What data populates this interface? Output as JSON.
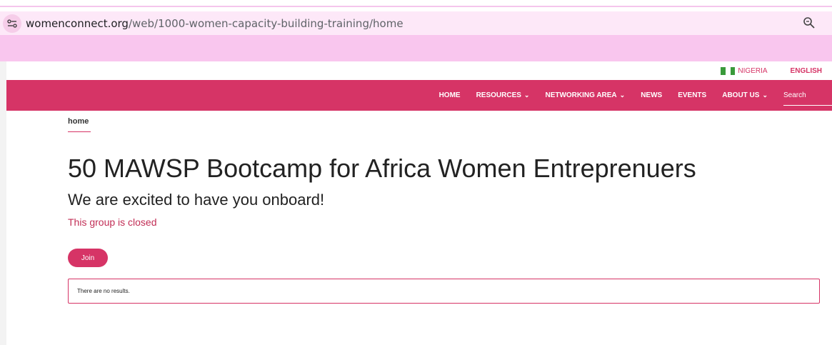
{
  "browser": {
    "url_domain": "womenconnect.org",
    "url_path": "/web/1000-women-capacity-building-training/home",
    "site_info_icon": "tune-icon",
    "zoom_icon": "zoom-icon"
  },
  "lang": {
    "country": "NIGERIA",
    "language": "ENGLISH",
    "flag_colors": [
      "#3a9a3a",
      "#ffffff",
      "#3a9a3a"
    ]
  },
  "nav": {
    "items": [
      {
        "label": "HOME",
        "dropdown": false
      },
      {
        "label": "RESOURCES",
        "dropdown": true
      },
      {
        "label": "NETWORKING AREA",
        "dropdown": true
      },
      {
        "label": "NEWS",
        "dropdown": false
      },
      {
        "label": "EVENTS",
        "dropdown": false
      },
      {
        "label": "ABOUT US",
        "dropdown": true
      }
    ],
    "search_placeholder": "Search",
    "chevron": "⌄"
  },
  "breadcrumb": "home",
  "content": {
    "title": "50 MAWSP Bootcamp for Africa Women Entreprenuers",
    "subtitle": "We are excited to have you onboard!",
    "status": "This group is closed",
    "join_label": "Join",
    "results_text": "There are no results."
  },
  "colors": {
    "accent": "#d63466",
    "tab_bg": "#f9c6ee",
    "address_bg": "#fde8f8"
  }
}
